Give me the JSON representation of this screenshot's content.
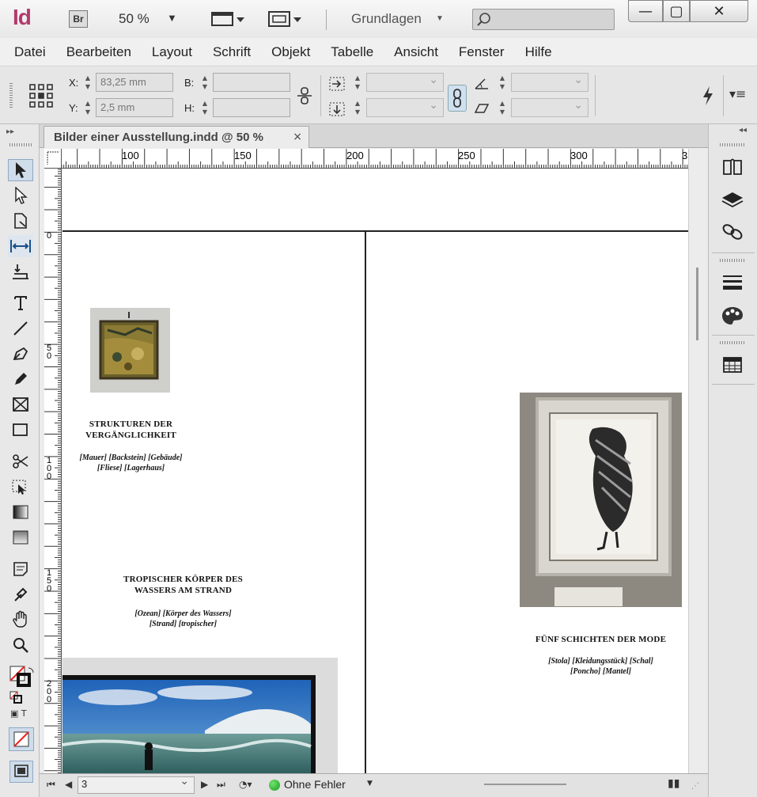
{
  "app": {
    "logo": "Id",
    "bridge_badge": "Br",
    "zoom": "50 %",
    "workspace": "Grundlagen"
  },
  "menu": [
    "Datei",
    "Bearbeiten",
    "Layout",
    "Schrift",
    "Objekt",
    "Tabelle",
    "Ansicht",
    "Fenster",
    "Hilfe"
  ],
  "control_panel": {
    "x_label": "X:",
    "x_value": "83,25 mm",
    "y_label": "Y:",
    "y_value": "2,5 mm",
    "w_label": "B:",
    "w_value": "",
    "h_label": "H:",
    "h_value": ""
  },
  "document": {
    "tab_title": "Bilder einer Ausstellung.indd @ 50 %",
    "tab_close": "×"
  },
  "rulers": {
    "horizontal": [
      "100",
      "150",
      "200",
      "250",
      "300",
      "3"
    ],
    "vertical": [
      "0",
      "5\n0",
      "1\n0\n0",
      "1\n5\n0",
      "2\n0\n0"
    ]
  },
  "captions": {
    "left_1_title": "STRUKTUREN DER\nVERGÄNGLICHKEIT",
    "left_1_tags": "[Mauer] [Backstein] [Gebäude]\n[Fliese] [Lagerhaus]",
    "left_2_title": "TROPISCHER KÖRPER DES\nWASSERS AM STRAND",
    "left_2_tags": "[Ozean] [Körper des Wassers]\n[Strand] [tropischer]",
    "right_1_title": "FÜNF SCHICHTEN DER MODE",
    "right_1_tags": "[Stola] [Kleidungsstück] [Schal]\n[Poncho] [Mantel]"
  },
  "status": {
    "page": "3",
    "preflight": "Ohne Fehler"
  }
}
